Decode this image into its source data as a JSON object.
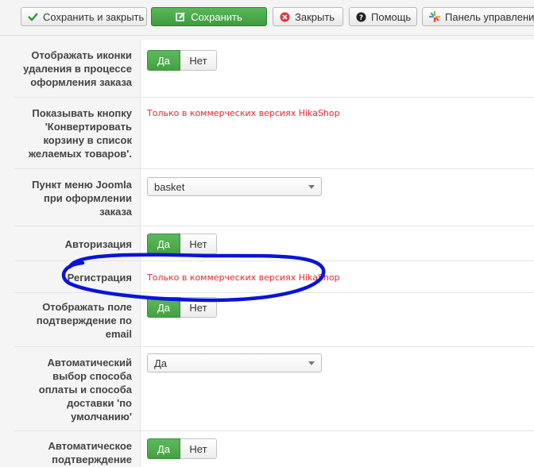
{
  "toolbar": {
    "save_close": "Сохранить и закрыть",
    "save": "Сохранить",
    "close": "Закрыть",
    "help": "Помощь",
    "control_panel": "Панель управления"
  },
  "rows": [
    {
      "label": "Отображать иконки удаления в процессе оформления заказа",
      "type": "toggle",
      "yes": "Да",
      "no": "Нет",
      "value": "Да"
    },
    {
      "label": "Показывать кнопку 'Конвертировать корзину в список желаемых товаров'.",
      "type": "commercial",
      "note": "Только в коммерческих версиях HikaShop"
    },
    {
      "label": "Пункт меню Joomla при оформлении заказа",
      "type": "select",
      "value": "basket"
    },
    {
      "label": "Авторизация",
      "type": "toggle",
      "yes": "Да",
      "no": "Нет",
      "value": "Да"
    },
    {
      "label": "Регистрация",
      "type": "commercial",
      "note": "Только в коммерческих версиях HikaShop"
    },
    {
      "label": "Отображать поле подтверждение по email",
      "type": "toggle",
      "yes": "Да",
      "no": "Нет",
      "value": "Да"
    },
    {
      "label": "Автоматический выбор способа оплаты и способа доставки 'по умолчанию'",
      "type": "select",
      "value": "Да"
    },
    {
      "label": "Автоматическое подтверждение",
      "type": "toggle",
      "yes": "Да",
      "no": "Нет",
      "value": "Да"
    }
  ],
  "colors": {
    "accent_green": "#4cae4c",
    "commercial_red": "#e8262e",
    "annotation_blue": "#0a14d8"
  },
  "icons": [
    "check-icon",
    "edit-icon",
    "close-circle-icon",
    "help-icon",
    "joomla-icon"
  ]
}
